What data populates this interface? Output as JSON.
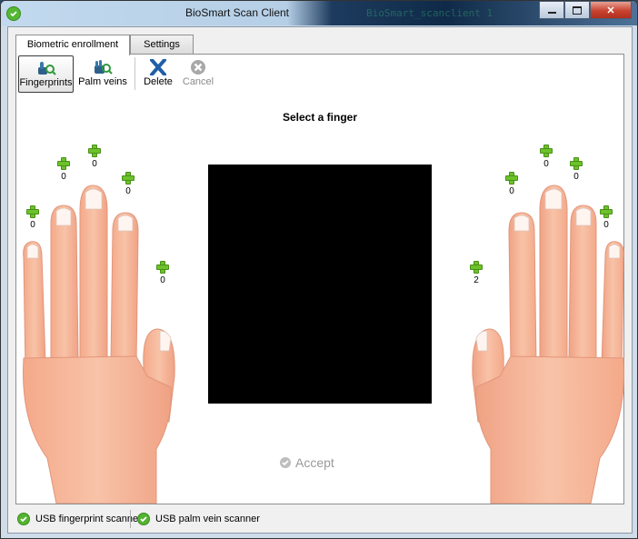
{
  "window": {
    "title": "BioSmart Scan Client",
    "background_title_text": "BioSmart_scanclient 1"
  },
  "tabs": [
    {
      "label": "Biometric enrollment",
      "active": true
    },
    {
      "label": "Settings",
      "active": false
    }
  ],
  "toolbar": {
    "fingerprints_label": "Fingerprints",
    "palm_veins_label": "Palm veins",
    "delete_label": "Delete",
    "cancel_label": "Cancel"
  },
  "main": {
    "prompt": "Select a finger",
    "accept_label": "Accept"
  },
  "left_hand": {
    "pinky_count": "0",
    "ring_count": "0",
    "middle_count": "0",
    "index_count": "0",
    "thumb_count": "0"
  },
  "right_hand": {
    "thumb_count": "2",
    "index_count": "0",
    "middle_count": "0",
    "ring_count": "0",
    "pinky_count": "0"
  },
  "status": {
    "fingerprint_scanner": "USB fingerprint scanner",
    "palm_vein_scanner": "USB palm vein scanner"
  },
  "colors": {
    "accent_green": "#6cc22a",
    "status_ok": "#53b431",
    "skin": "#f6b89a",
    "scan_area": "#000000"
  },
  "icons": {
    "app": "check-circle-icon",
    "fingerprints": "fingerprint-scan-icon",
    "palm_veins": "palm-scan-icon",
    "delete": "x-icon",
    "cancel": "cancel-circle-icon",
    "add": "plus-icon"
  }
}
